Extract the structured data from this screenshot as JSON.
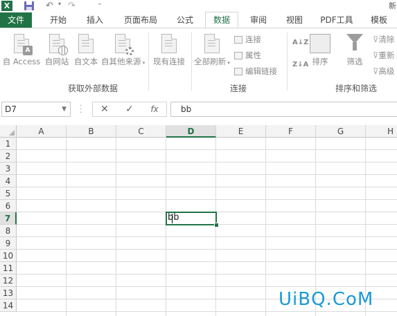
{
  "titlebar": {
    "app_icon": "X",
    "title_fragment": "新",
    "icons": [
      "excel-logo-icon",
      "save-icon",
      "undo-icon",
      "redo-icon",
      "customize-quick-access-icon"
    ]
  },
  "tabs": [
    {
      "label": "文件",
      "kind": "file"
    },
    {
      "label": "开始"
    },
    {
      "label": "插入"
    },
    {
      "label": "页面布局"
    },
    {
      "label": "公式"
    },
    {
      "label": "数据",
      "active": true
    },
    {
      "label": "审阅"
    },
    {
      "label": "视图"
    },
    {
      "label": "PDF工具"
    },
    {
      "label": "模板"
    }
  ],
  "ribbon": {
    "get_external": {
      "group_label": "获取外部数据",
      "from_access": "自 Access",
      "from_web": "自网站",
      "from_text": "自文本",
      "from_other": "自其他来源",
      "existing_conn": "现有连接"
    },
    "connections": {
      "group_label": "连接",
      "refresh_all": "全部刷新",
      "connections": "连接",
      "properties": "属性",
      "edit_links": "编辑链接"
    },
    "sort_filter": {
      "group_label": "排序和筛选",
      "sort_az": "A↓Z",
      "sort_za": "Z↓A",
      "sort": "排序",
      "filter": "筛选",
      "clear": "清除",
      "reapply": "重新",
      "advanced": "高级"
    }
  },
  "formula_bar": {
    "name_box": "D7",
    "cancel_symbol": "✕",
    "enter_symbol": "✓",
    "fx_symbol": "fx",
    "formula": "bb"
  },
  "sheet": {
    "columns": [
      "A",
      "B",
      "C",
      "D",
      "E",
      "F",
      "G",
      "H"
    ],
    "rows": [
      "1",
      "2",
      "3",
      "4",
      "5",
      "6",
      "7",
      "8",
      "9",
      "10",
      "11",
      "12",
      "13",
      "14"
    ],
    "selected_column": "D",
    "selected_row": "7",
    "active_cell_value": "bb"
  },
  "watermark": "UiBQ.CoM",
  "colors": {
    "accent": "#217346",
    "watermark": "#1a9ad6"
  }
}
